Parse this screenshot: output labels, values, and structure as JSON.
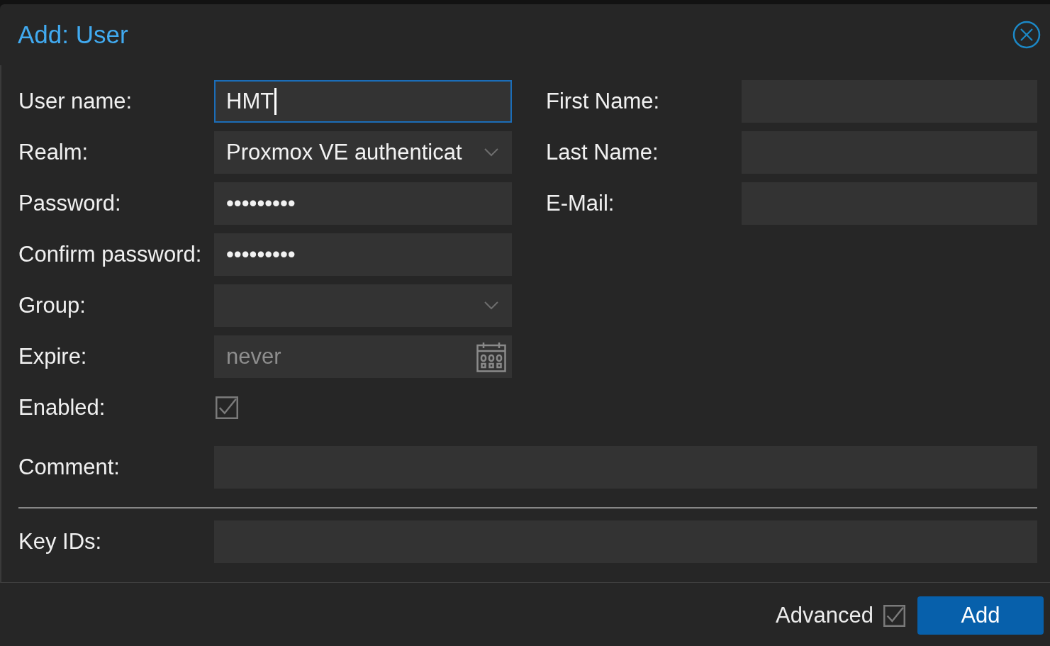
{
  "dialog": {
    "title": "Add: User"
  },
  "left_fields": [
    {
      "kind": "text",
      "label": "User name:",
      "value": "HMT",
      "focused": true
    },
    {
      "kind": "select",
      "label": "Realm:",
      "value": "Proxmox VE authenticat",
      "focused": false
    },
    {
      "kind": "password",
      "label": "Password:",
      "value": "•••••••••",
      "focused": false
    },
    {
      "kind": "password",
      "label": "Confirm password:",
      "value": "•••••••••",
      "focused": false
    },
    {
      "kind": "select",
      "label": "Group:",
      "focused": false
    },
    {
      "kind": "date",
      "label": "Expire:",
      "placeholder": "never",
      "focused": false
    }
  ],
  "right_fields": [
    {
      "kind": "text",
      "label": "First Name:",
      "focused": false
    },
    {
      "kind": "text",
      "label": "Last Name:",
      "focused": false
    },
    {
      "kind": "text",
      "label": "E-Mail:",
      "focused": false
    }
  ],
  "enabled": {
    "label": "Enabled:",
    "checked": true
  },
  "comment": {
    "kind": "text",
    "label": "Comment:",
    "focused": false
  },
  "key_ids": {
    "kind": "text",
    "label": "Key IDs:",
    "focused": false
  },
  "footer": {
    "advanced": {
      "label": "Advanced",
      "checked": true
    },
    "add_button": {
      "label": "Add"
    }
  }
}
